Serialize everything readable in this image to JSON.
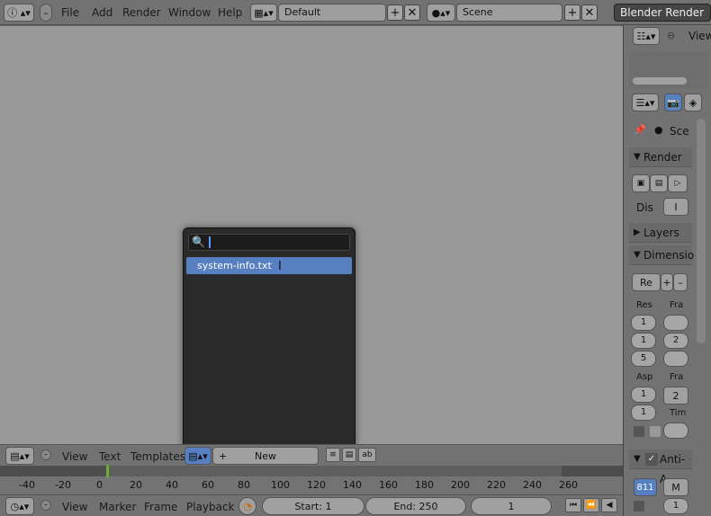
{
  "app": {
    "engine": "Blender Render"
  },
  "top_menu": {
    "items": [
      "File",
      "Add",
      "Render",
      "Window",
      "Help"
    ],
    "layout": "Default",
    "scene": "Scene"
  },
  "right_top": {
    "view_label": "View"
  },
  "properties": {
    "scene_label": "Sce",
    "render_header": "Render",
    "display_label": "Dis",
    "display_value": "I",
    "layers_header": "Layers",
    "dimensions_header": "Dimensio",
    "preset_label": "Re",
    "res_label": "Res",
    "frame_label": "Fra",
    "res_values": [
      "1",
      "1",
      "5"
    ],
    "frame_values": [
      "",
      "2",
      ""
    ],
    "aspect_label": "Asp",
    "fps_label": "Fra",
    "aspect_values": [
      "1",
      "1"
    ],
    "fps_value": "2",
    "time_label": "Tim",
    "antialias_header": "Anti-A",
    "aa_value": "8",
    "aa_value2": "11",
    "m_value": "M",
    "one_value": "1"
  },
  "popup": {
    "search_placeholder": "",
    "results": [
      "system-info.txt"
    ]
  },
  "text_header": {
    "menus": [
      "View",
      "Text",
      "Templates"
    ],
    "new_label": "New"
  },
  "timeline": {
    "ticks": [
      "-40",
      "-20",
      "0",
      "20",
      "40",
      "60",
      "80",
      "100",
      "120",
      "140",
      "160",
      "180",
      "200",
      "220",
      "240",
      "260"
    ],
    "current_frame": "0"
  },
  "timeline_header": {
    "menus": [
      "View",
      "Marker",
      "Frame",
      "Playback"
    ],
    "start": "Start: 1",
    "end": "End: 250",
    "frame": "1"
  }
}
